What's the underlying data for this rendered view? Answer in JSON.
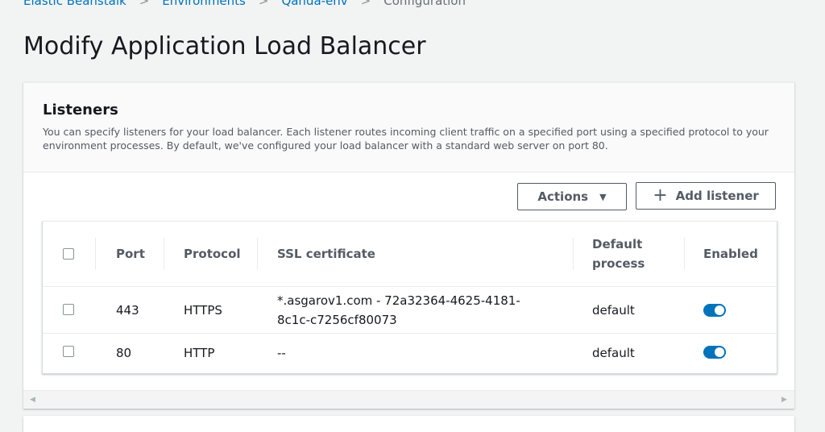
{
  "breadcrumb": {
    "items": [
      "Elastic Beanstalk",
      "Environments",
      "Qanda-env",
      "Configuration"
    ],
    "separator": ">"
  },
  "page": {
    "title": "Modify Application Load Balancer"
  },
  "listeners": {
    "title": "Listeners",
    "description": "You can specify listeners for your load balancer. Each listener routes incoming client traffic on a specified port using a specified protocol to your environment processes. By default, we've configured your load balancer with a standard web server on port 80.",
    "actions_label": "Actions",
    "actions_caret": "▼",
    "add_icon": "+",
    "add_label": "Add listener",
    "table": {
      "columns": {
        "port": "Port",
        "protocol": "Protocol",
        "ssl": "SSL certificate",
        "process_line1": "Default",
        "process_line2": "process",
        "enabled": "Enabled"
      },
      "rows": [
        {
          "port": "443",
          "protocol": "HTTPS",
          "ssl_line1": "*.asgarov1.com - 72a32364-4625-4181-",
          "ssl_line2": "8c1c-c7256cf80073",
          "process": "default",
          "enabled": true
        },
        {
          "port": "80",
          "protocol": "HTTP",
          "ssl_line1": "--",
          "process": "default",
          "enabled": true
        }
      ]
    }
  },
  "icons": {
    "caret": "caret-down-icon",
    "add": "plus-icon",
    "scroll_left": "scroll-left-icon",
    "scroll_right": "scroll-right-icon"
  },
  "scroll": {
    "left": "◀",
    "right": "▶"
  },
  "colors": {
    "link": "#0073bb",
    "toggle_on": "#0073bb",
    "page_bg": "#f2f3f3"
  }
}
